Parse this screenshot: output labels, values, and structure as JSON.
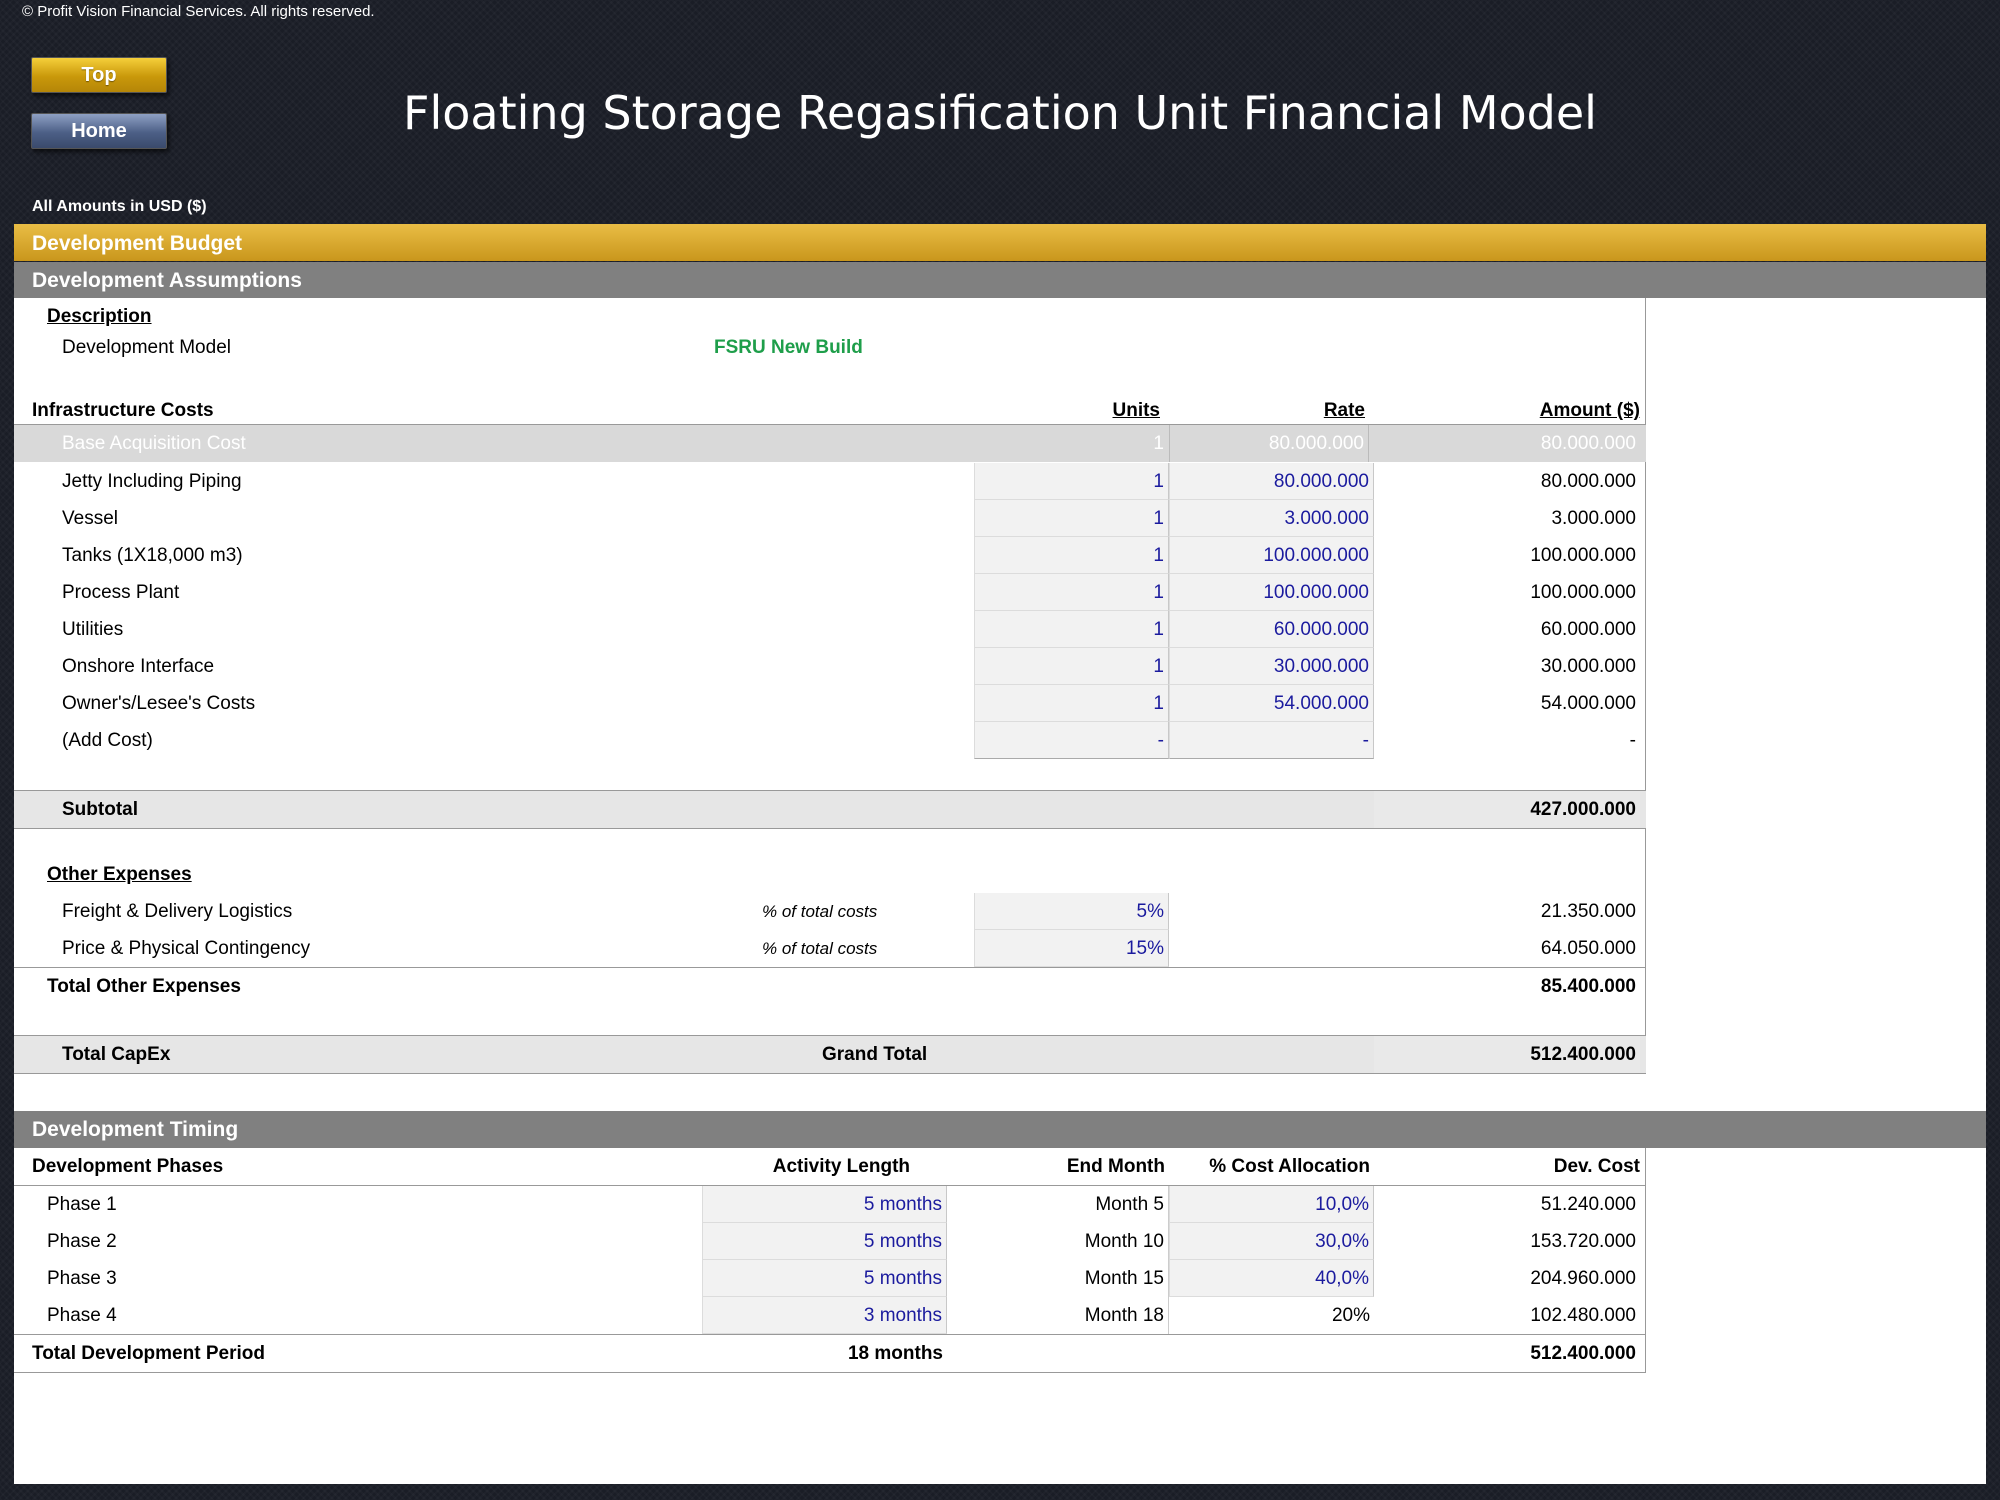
{
  "copyright": "© Profit Vision Financial Services. All rights reserved.",
  "nav": {
    "top_label": "Top",
    "home_label": "Home"
  },
  "title": "Floating Storage Regasification Unit Financial Model",
  "amounts_note": "All Amounts in  USD ($)",
  "sections": {
    "budget": "Development Budget",
    "assumptions": "Development Assumptions",
    "timing": "Development Timing"
  },
  "description": {
    "heading": "Description",
    "model_label": "Development Model",
    "model_value": "FSRU New Build"
  },
  "infrastructure": {
    "heading": "Infrastructure Costs",
    "col_units": "Units",
    "col_rate": "Rate",
    "col_amount": "Amount ($)",
    "rows": [
      {
        "label": "Base Acquisition Cost",
        "units": "1",
        "rate": "80.000.000",
        "amount": "80.000.000"
      },
      {
        "label": "Jetty Including Piping",
        "units": "1",
        "rate": "80.000.000",
        "amount": "80.000.000"
      },
      {
        "label": "Vessel",
        "units": "1",
        "rate": "3.000.000",
        "amount": "3.000.000"
      },
      {
        "label": "Tanks (1X18,000 m3)",
        "units": "1",
        "rate": "100.000.000",
        "amount": "100.000.000"
      },
      {
        "label": "Process Plant",
        "units": "1",
        "rate": "100.000.000",
        "amount": "100.000.000"
      },
      {
        "label": "Utilities",
        "units": "1",
        "rate": "60.000.000",
        "amount": "60.000.000"
      },
      {
        "label": "Onshore Interface",
        "units": "1",
        "rate": "30.000.000",
        "amount": "30.000.000"
      },
      {
        "label": "Owner's/Lesee's Costs",
        "units": "1",
        "rate": "54.000.000",
        "amount": "54.000.000"
      },
      {
        "label": "(Add Cost)",
        "units": "-",
        "rate": "-",
        "amount": "-"
      }
    ],
    "subtotal_label": "Subtotal",
    "subtotal_value": "427.000.000"
  },
  "other_expenses": {
    "heading": "Other Expenses",
    "rows": [
      {
        "label": "Freight & Delivery Logistics",
        "basis": "% of total costs",
        "pct": "5%",
        "amount": "21.350.000"
      },
      {
        "label": "Price & Physical Contingency",
        "basis": "% of total costs",
        "pct": "15%",
        "amount": "64.050.000"
      }
    ],
    "total_label": "Total Other Expenses",
    "total_value": "85.400.000"
  },
  "capex": {
    "label": "Total CapEx",
    "grand_label": "Grand Total",
    "value": "512.400.000"
  },
  "timing": {
    "col_phases": "Development Phases",
    "col_length": "Activity Length",
    "col_end": "End Month",
    "col_alloc": "% Cost Allocation",
    "col_cost": "Dev. Cost",
    "rows": [
      {
        "phase": "Phase 1",
        "length": "5 months",
        "end": "Month 5",
        "alloc": "10,0%",
        "cost": "51.240.000"
      },
      {
        "phase": "Phase 2",
        "length": "5 months",
        "end": "Month 10",
        "alloc": "30,0%",
        "cost": "153.720.000"
      },
      {
        "phase": "Phase 3",
        "length": "5 months",
        "end": "Month 15",
        "alloc": "40,0%",
        "cost": "204.960.000"
      },
      {
        "phase": "Phase 4",
        "length": "3 months",
        "end": "Month 18",
        "alloc": "20%",
        "cost": "102.480.000"
      }
    ],
    "total_label": "Total Development Period",
    "total_length": "18 months",
    "total_cost": "512.400.000"
  }
}
